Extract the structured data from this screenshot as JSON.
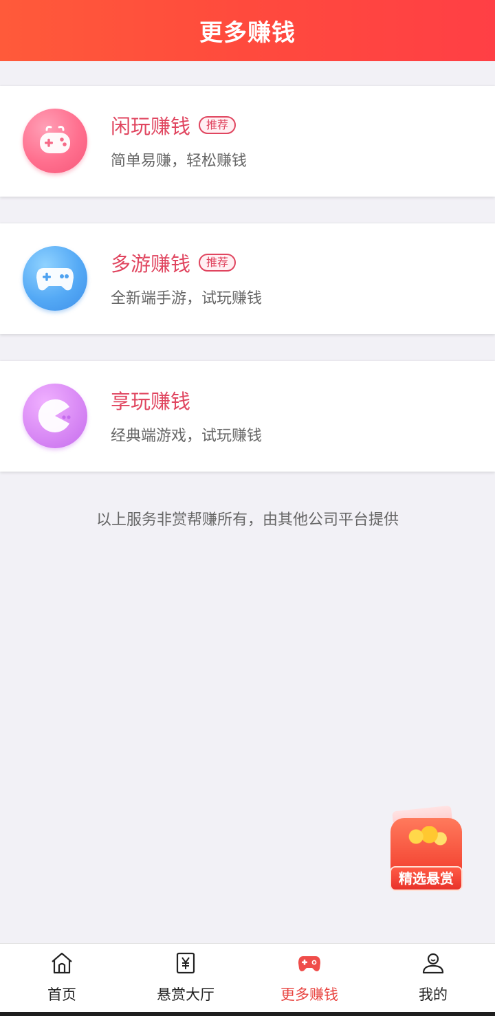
{
  "header": {
    "title": "更多赚钱"
  },
  "items": [
    {
      "name": "闲玩赚钱",
      "badge": "推荐",
      "desc": "简单易赚，轻松赚钱",
      "icon": "game-controller-icon",
      "color": "#f65779"
    },
    {
      "name": "多游赚钱",
      "badge": "推荐",
      "desc": "全新端手游，试玩赚钱",
      "icon": "gamepad-icon",
      "color": "#3d8fe9"
    },
    {
      "name": "享玩赚钱",
      "badge": "",
      "desc": "经典端游戏，试玩赚钱",
      "icon": "pacman-icon",
      "color": "#c56ced"
    }
  ],
  "footnote": "以上服务非赏帮赚所有，由其他公司平台提供",
  "float_bonus": {
    "label": "精选悬赏",
    "icon": "red-envelope-icon"
  },
  "tabbar": {
    "active_index": 2,
    "tabs": [
      {
        "label": "首页",
        "icon": "home-icon"
      },
      {
        "label": "悬赏大厅",
        "icon": "yuan-icon"
      },
      {
        "label": "更多赚钱",
        "icon": "gamepad-icon"
      },
      {
        "label": "我的",
        "icon": "user-icon"
      }
    ]
  },
  "colors": {
    "accent": "#e8433f",
    "item_title": "#e0455f"
  }
}
